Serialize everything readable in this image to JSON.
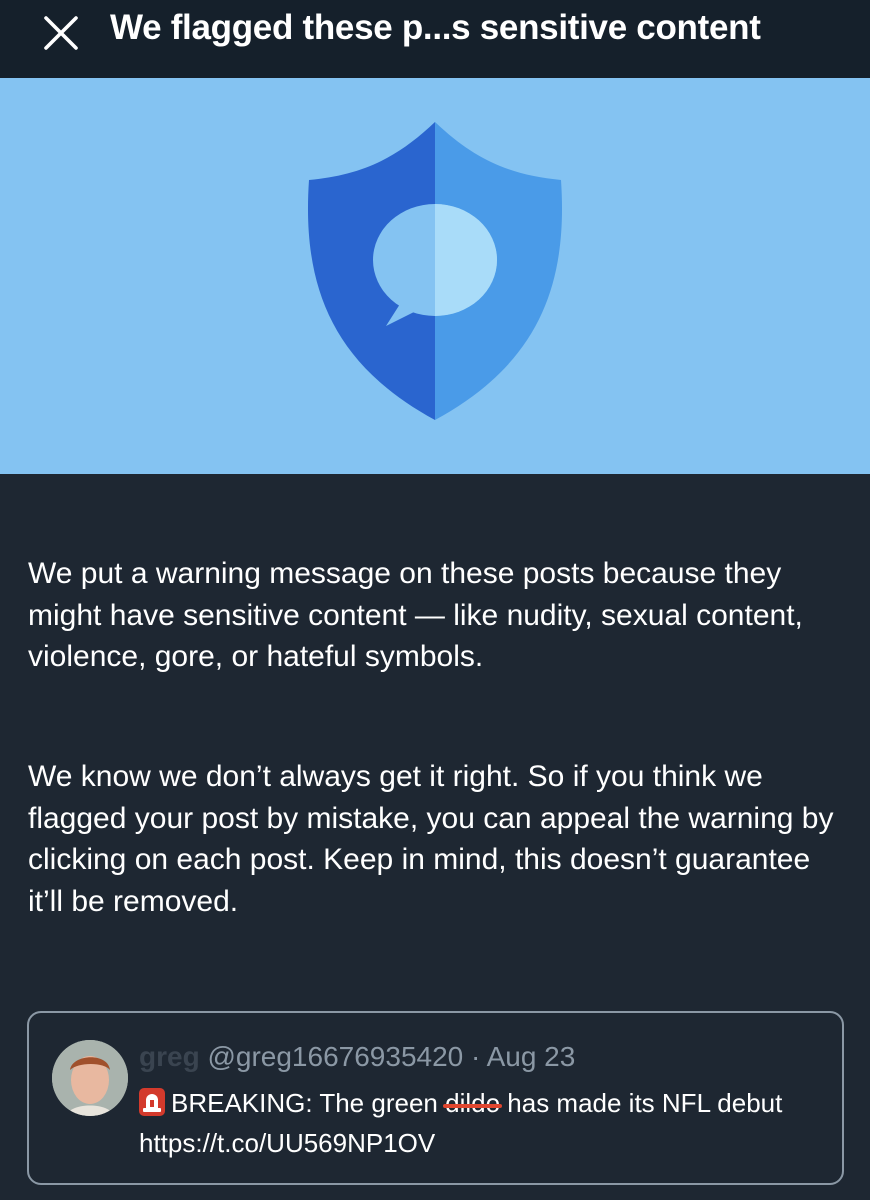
{
  "header": {
    "title": "We flagged these p...s sensitive content",
    "close_icon": "close-icon"
  },
  "hero": {
    "icon": "shield-chat-icon",
    "colors": {
      "background": "#84c3f2",
      "shield_left": "#2a65cf",
      "shield_right": "#4a9be8",
      "bubble_left": "#84c3f2",
      "bubble_right": "#a9dcf9"
    }
  },
  "body": {
    "paragraph1": "We put a warning message on these posts because they might have sensitive content — like nudity, sexual content, violence, gore, or hateful symbols.",
    "paragraph2": "We know we don’t always get it right. So if you think we flagged your post by mistake, you can appeal the warning by clicking on each post. Keep in mind, this doesn’t guarantee it’ll be removed."
  },
  "post": {
    "display_name": "greg",
    "handle": "@greg16676935420",
    "separator": "·",
    "date": "Aug 23",
    "emoji_icon": "siren-icon",
    "text_before": "BREAKING: The green",
    "text_struck": "dildo",
    "text_after": "has made its NFL debut https://t.co/UU569NP1OV"
  }
}
